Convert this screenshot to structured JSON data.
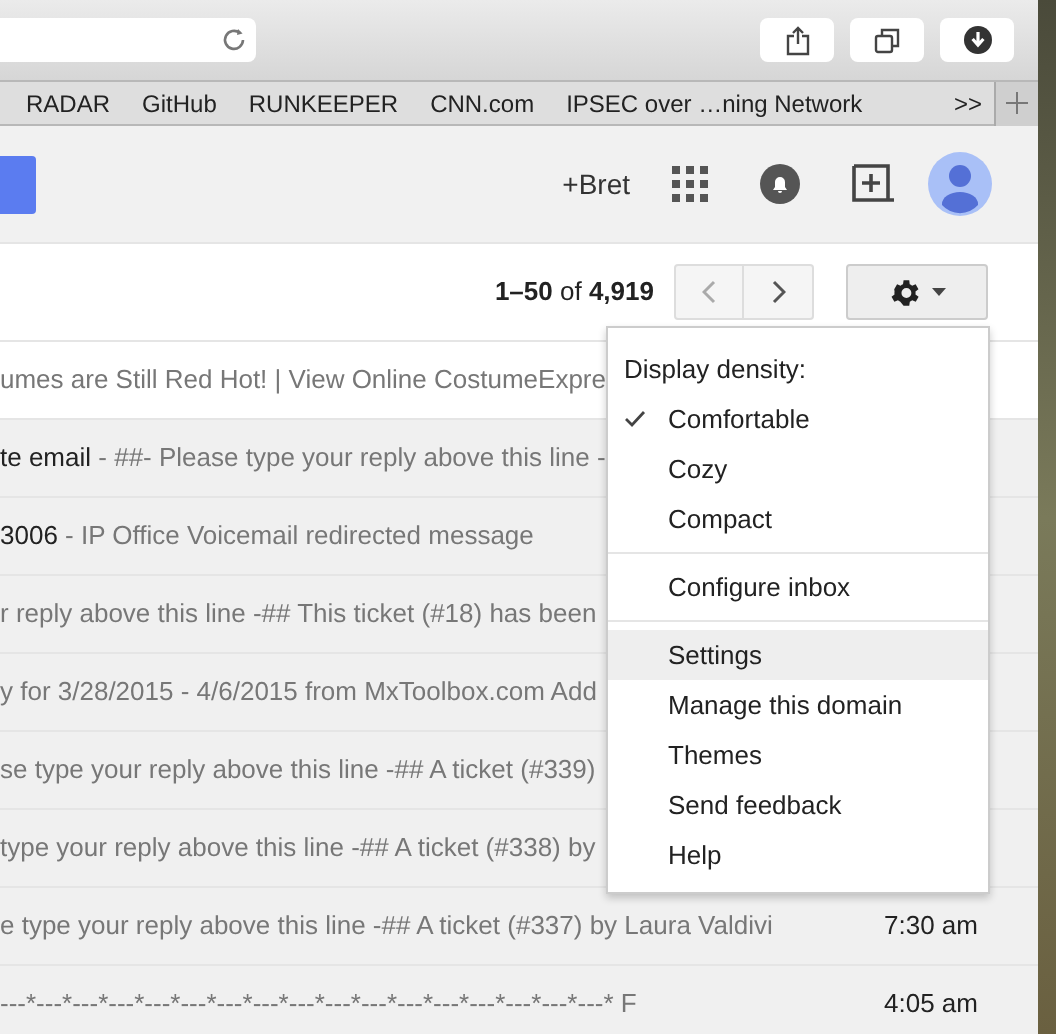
{
  "bookmarks": [
    "RADAR",
    "GitHub",
    "RUNKEEPER",
    "CNN.com",
    "IPSEC over …ning Network"
  ],
  "bookmarks_overflow": ">>",
  "header": {
    "plus_user": "+Bret"
  },
  "pager": {
    "range": "1–50",
    "of": "of",
    "total": "4,919"
  },
  "emails": [
    {
      "snippet": "umes are Still Red Hot! | View Online CostumeExpre",
      "unread": false
    },
    {
      "subject": "te email",
      "snippet": " - ##- Please type your reply above this line -",
      "unread": true
    },
    {
      "subject": "3006",
      "snippet": " - IP Office Voicemail redirected message",
      "unread": true
    },
    {
      "snippet": "r reply above this line -## This ticket (#18) has been",
      "unread": true
    },
    {
      "snippet": "y for 3/28/2015 - 4/6/2015 from MxToolbox.com Add",
      "unread": true
    },
    {
      "snippet": "se type your reply above this line -## A ticket (#339)",
      "unread": true
    },
    {
      "snippet": " type your reply above this line -## A ticket (#338) by",
      "unread": true
    },
    {
      "snippet": "e type your reply above this line -## A ticket (#337) by Laura Valdivi",
      "time": "7:30 am",
      "unread": true
    },
    {
      "snippet": "---*---*---*---*---*---*---*---*---*---*---*---*---*---*---*---*---* F",
      "time": "4:05 am",
      "unread": true
    }
  ],
  "settings_menu": {
    "heading": "Display density:",
    "items": [
      {
        "kind": "density",
        "label": "Comfortable",
        "checked": true,
        "highlighted": false
      },
      {
        "kind": "density",
        "label": "Cozy",
        "checked": false,
        "highlighted": false
      },
      {
        "kind": "density",
        "label": "Compact",
        "checked": false,
        "highlighted": false
      },
      {
        "kind": "divider"
      },
      {
        "kind": "action",
        "label": "Configure inbox",
        "highlighted": false
      },
      {
        "kind": "divider"
      },
      {
        "kind": "action",
        "label": "Settings",
        "highlighted": true
      },
      {
        "kind": "action",
        "label": "Manage this domain",
        "highlighted": false
      },
      {
        "kind": "action",
        "label": "Themes",
        "highlighted": false
      },
      {
        "kind": "action",
        "label": "Send feedback",
        "highlighted": false
      },
      {
        "kind": "action",
        "label": "Help",
        "highlighted": false
      }
    ]
  }
}
